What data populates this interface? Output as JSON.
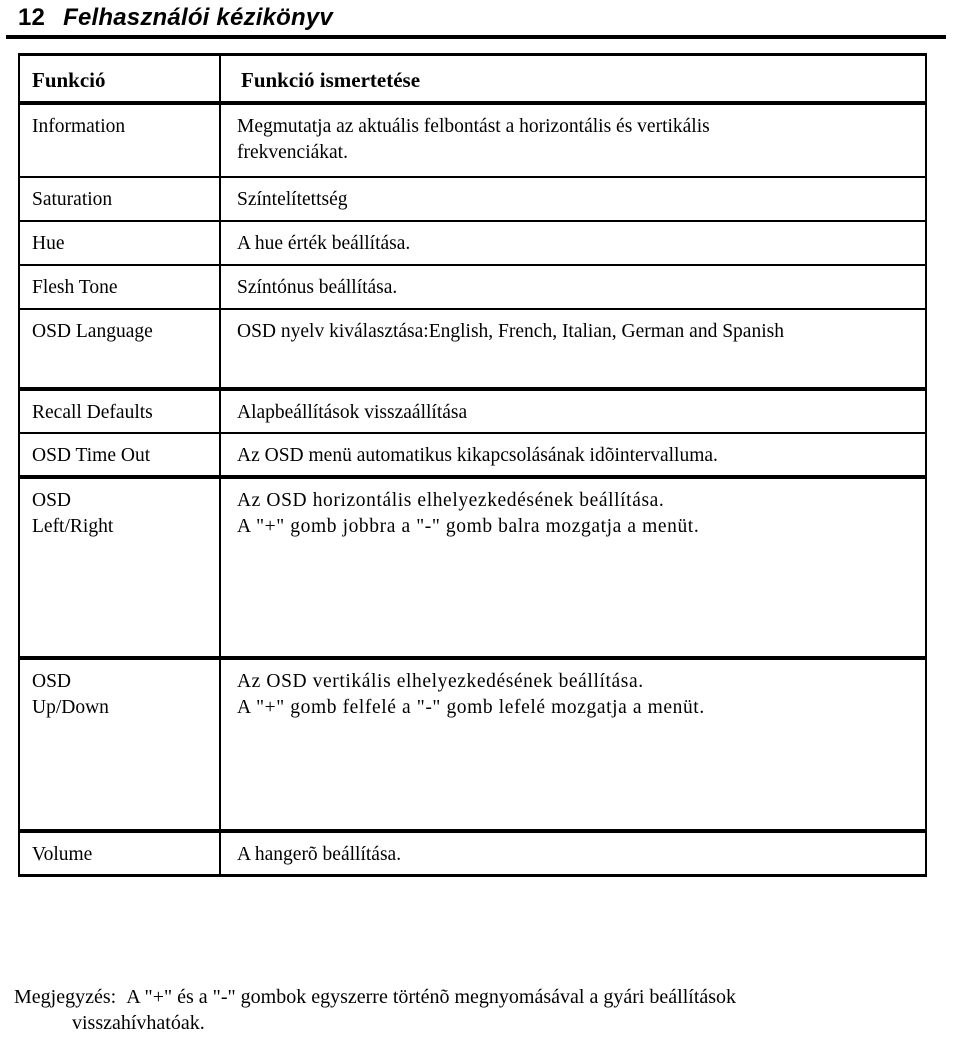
{
  "header": {
    "page_number": "12",
    "title": "Felhasználói kézikönyv"
  },
  "table": {
    "columns": {
      "function": "Funkció",
      "description": "Funkció ismertetése"
    },
    "rows": [
      {
        "function": "Information",
        "desc_line1": "Megmutatja az aktuális felbontást a horizontális és vertikális",
        "desc_line2": "frekvenciákat."
      },
      {
        "function": "Saturation",
        "desc_line1": "Színtelítettség",
        "desc_line2": ""
      },
      {
        "function": "Hue",
        "desc_line1": "A hue érték beállítása.",
        "desc_line2": ""
      },
      {
        "function": "Flesh Tone",
        "desc_line1": "Színtónus beállítása.",
        "desc_line2": ""
      },
      {
        "function": "OSD Language",
        "desc_line1": "OSD nyelv kiválasztása:English, French, Italian, German and Spanish",
        "desc_line2": ""
      },
      {
        "function": "Recall Defaults",
        "desc_line1": "Alapbeállítások visszaállítása",
        "desc_line2": ""
      },
      {
        "function": "OSD Time Out",
        "desc_line1": "Az OSD menü automatikus kikapcsolásának idõintervalluma.",
        "desc_line2": ""
      },
      {
        "function_line1": "OSD",
        "function_line2": "Left/Right",
        "desc_line1": "Az OSD horizontális elhelyezkedésének beállítása.",
        "desc_line2": "A \"+\" gomb jobbra a \"-\" gomb balra mozgatja a menüt."
      },
      {
        "function_line1": "OSD",
        "function_line2": "Up/Down",
        "desc_line1": "Az OSD vertikális elhelyezkedésének beállítása.",
        "desc_line2": "A \"+\" gomb felfelé a \"-\" gomb lefelé mozgatja a menüt."
      },
      {
        "function": "Volume",
        "desc_line1": "A hangerõ beállítása.",
        "desc_line2": ""
      }
    ]
  },
  "note": {
    "label": "Megjegyzés:",
    "line1": "A \"+\" és a \"-\" gombok egyszerre történõ megnyomásával a gyári beállítások",
    "line2": "visszahívhatóak."
  }
}
